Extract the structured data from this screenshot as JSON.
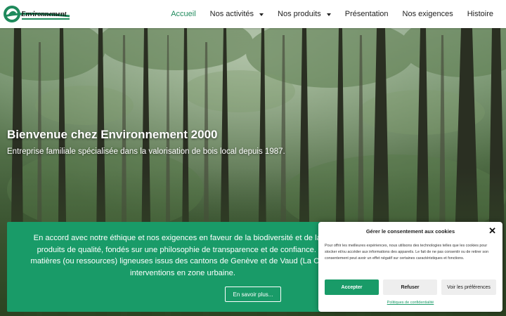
{
  "header": {
    "logo_text": "Environnement",
    "nav": [
      {
        "label": "Accueil",
        "active": true,
        "has_dropdown": false
      },
      {
        "label": "Nos activités",
        "active": false,
        "has_dropdown": true
      },
      {
        "label": "Nos produits",
        "active": false,
        "has_dropdown": true
      },
      {
        "label": "Présentation",
        "active": false,
        "has_dropdown": false
      },
      {
        "label": "Nos exigences",
        "active": false,
        "has_dropdown": false
      },
      {
        "label": "Histoire",
        "active": false,
        "has_dropdown": false
      }
    ]
  },
  "hero": {
    "title": "Bienvenue chez Environnement 2000",
    "subtitle": "Entreprise familiale spécialisée dans la valorisation de bois local depuis 1987."
  },
  "info": {
    "lines": [
      "En accord avec notre éthique et nos exigences en faveur de la biodiversité et de la du",
      "produits de qualité, fondés sur une philosophie de transparence et de confiance. No",
      "matières (ou ressources) ligneuses issus des cantons de Genève et de Vaud (La Côte),",
      "interventions en zone urbaine."
    ],
    "button_label": "En savoir plus..."
  },
  "cookie": {
    "title": "Gérer le consentement aux cookies",
    "close_symbol": "✕",
    "text": "Pour offrir les meilleures expériences, nous utilisons des technologies telles que les cookies pour stocker et/ou accéder aux informations des appareils. Le fait de ne pas consentir ou de retirer son consentement peut avoir un effet négatif sur certaines caractéristiques et fonctions.",
    "accept_label": "Accepter",
    "refuse_label": "Refuser",
    "prefs_label": "Voir les préférences",
    "policy_link": "Politiques de confidentialité"
  },
  "colors": {
    "accent": "#199b68",
    "nav_active": "#1f8a5c"
  }
}
